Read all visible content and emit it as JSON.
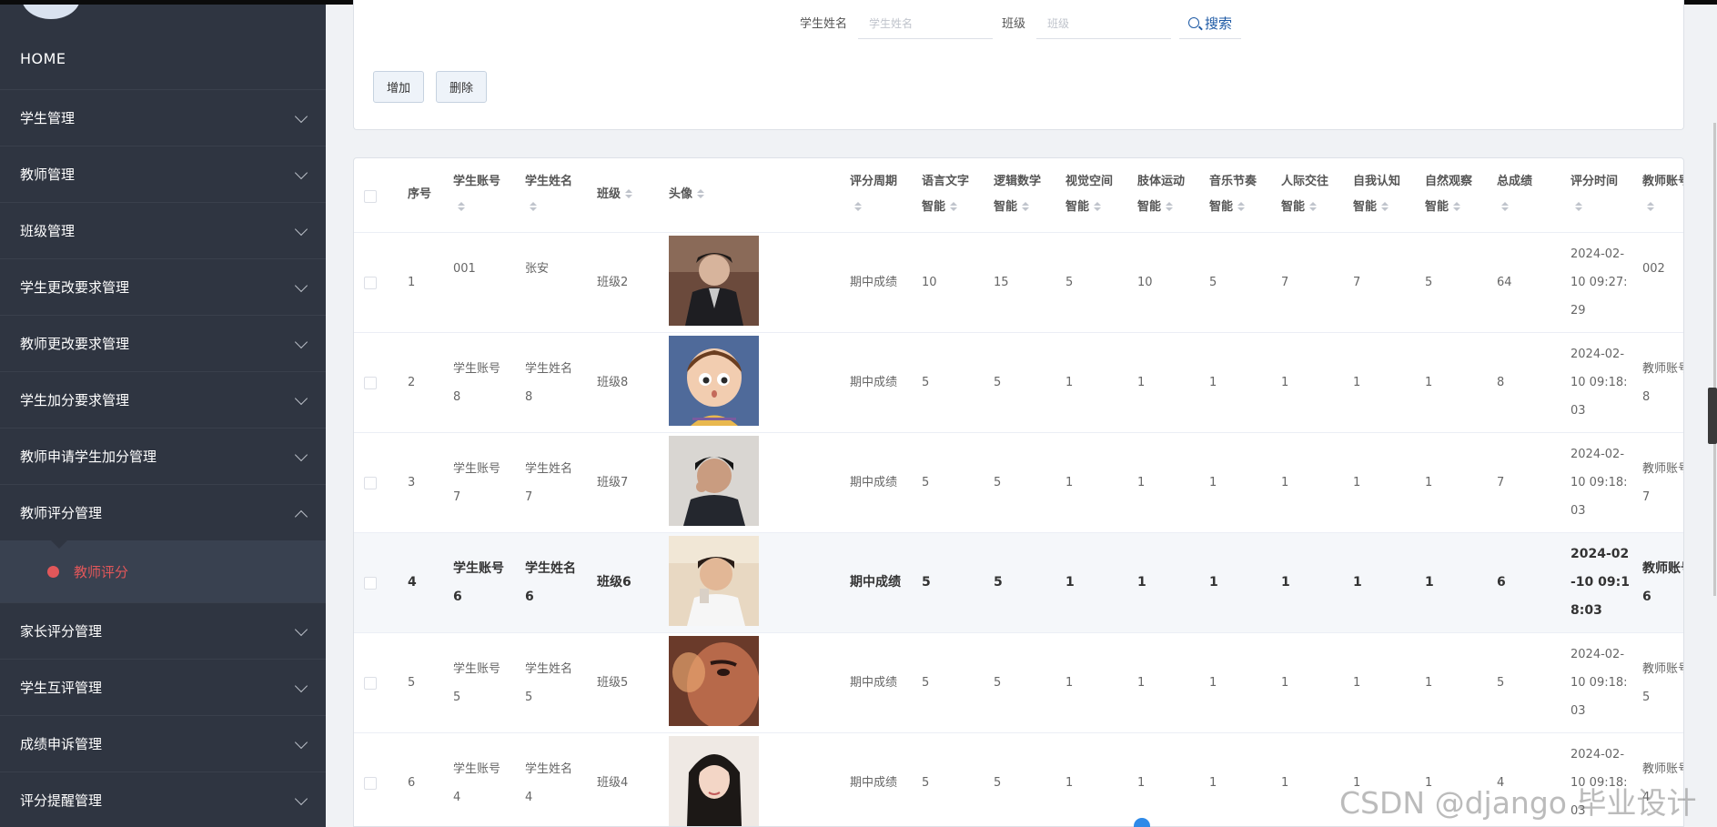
{
  "sidebar": {
    "home": "HOME",
    "items": [
      {
        "label": "学生管理"
      },
      {
        "label": "教师管理"
      },
      {
        "label": "班级管理"
      },
      {
        "label": "学生更改要求管理"
      },
      {
        "label": "教师更改要求管理"
      },
      {
        "label": "学生加分要求管理"
      },
      {
        "label": "教师申请学生加分管理"
      },
      {
        "label": "教师评分管理"
      }
    ],
    "active_sub": "教师评分",
    "items_after": [
      {
        "label": "家长评分管理"
      },
      {
        "label": "学生互评管理"
      },
      {
        "label": "成绩申诉管理"
      },
      {
        "label": "评分提醒管理"
      }
    ]
  },
  "search": {
    "name_label": "学生姓名",
    "name_placeholder": "学生姓名",
    "class_label": "班级",
    "class_placeholder": "班级",
    "search_button": "搜索",
    "add_button": "增加",
    "delete_button": "删除"
  },
  "table": {
    "headers": {
      "index": "序号",
      "account": "学生账号",
      "name": "学生姓名",
      "class": "班级",
      "avatar": "头像",
      "period": "评分周期",
      "lang_1": "语言文字",
      "lang_2": "智能",
      "logic_1": "逻辑数学",
      "logic_2": "智能",
      "visual_1": "视觉空间",
      "visual_2": "智能",
      "body_1": "肢体运动",
      "body_2": "智能",
      "music_1": "音乐节奏",
      "music_2": "智能",
      "inter_1": "人际交往",
      "inter_2": "智能",
      "self_1": "自我认知",
      "self_2": "智能",
      "nature_1": "自然观察",
      "nature_2": "智能",
      "total": "总成绩",
      "time": "评分时间",
      "teacher": "教师账号"
    },
    "rows": [
      {
        "index": "1",
        "account_1": "001",
        "account_2": "",
        "name_1": "张安",
        "name_2": "",
        "class": "班级2",
        "period": "期中成绩",
        "lang": "10",
        "logic": "15",
        "visual": "5",
        "body": "10",
        "music": "5",
        "inter": "7",
        "self": "7",
        "nature": "5",
        "total": "64",
        "time_1": "2024-02-",
        "time_2": "10 09:27:",
        "time_3": "29",
        "teacher_1": "002",
        "teacher_2": "",
        "avatar_icon": "avatar-man-jacket"
      },
      {
        "index": "2",
        "account_1": "学生账号",
        "account_2": "8",
        "name_1": "学生姓名",
        "name_2": "8",
        "class": "班级8",
        "period": "期中成绩",
        "lang": "5",
        "logic": "5",
        "visual": "1",
        "body": "1",
        "music": "1",
        "inter": "1",
        "self": "1",
        "nature": "1",
        "total": "8",
        "time_1": "2024-02-",
        "time_2": "10 09:18:",
        "time_3": "03",
        "teacher_1": "教师账号",
        "teacher_2": "8",
        "avatar_icon": "avatar-cartoon-boy"
      },
      {
        "index": "3",
        "account_1": "学生账号",
        "account_2": "7",
        "name_1": "学生姓名",
        "name_2": "7",
        "class": "班级7",
        "period": "期中成绩",
        "lang": "5",
        "logic": "5",
        "visual": "1",
        "body": "1",
        "music": "1",
        "inter": "1",
        "self": "1",
        "nature": "1",
        "total": "7",
        "time_1": "2024-02-",
        "time_2": "10 09:18:",
        "time_3": "03",
        "teacher_1": "教师账号",
        "teacher_2": "7",
        "avatar_icon": "avatar-man-cap"
      },
      {
        "index": "4",
        "account_1": "学生账号",
        "account_2": "6",
        "name_1": "学生姓名",
        "name_2": "6",
        "class": "班级6",
        "period": "期中成绩",
        "lang": "5",
        "logic": "5",
        "visual": "1",
        "body": "1",
        "music": "1",
        "inter": "1",
        "self": "1",
        "nature": "1",
        "total": "6",
        "time_1": "2024-02",
        "time_2": "-10 09:1",
        "time_3": "8:03",
        "teacher_1": "教师账号",
        "teacher_2": "6",
        "avatar_icon": "avatar-boy-smile"
      },
      {
        "index": "5",
        "account_1": "学生账号",
        "account_2": "5",
        "name_1": "学生姓名",
        "name_2": "5",
        "class": "班级5",
        "period": "期中成绩",
        "lang": "5",
        "logic": "5",
        "visual": "1",
        "body": "1",
        "music": "1",
        "inter": "1",
        "self": "1",
        "nature": "1",
        "total": "5",
        "time_1": "2024-02-",
        "time_2": "10 09:18:",
        "time_3": "03",
        "teacher_1": "教师账号",
        "teacher_2": "5",
        "avatar_icon": "avatar-face-closeup"
      },
      {
        "index": "6",
        "account_1": "学生账号",
        "account_2": "4",
        "name_1": "学生姓名",
        "name_2": "4",
        "class": "班级4",
        "period": "期中成绩",
        "lang": "5",
        "logic": "5",
        "visual": "1",
        "body": "1",
        "music": "1",
        "inter": "1",
        "self": "1",
        "nature": "1",
        "total": "4",
        "time_1": "2024-02-",
        "time_2": "10 09:18:",
        "time_3": "03",
        "teacher_1": "教师账号",
        "teacher_2": "4",
        "avatar_icon": "avatar-girl"
      }
    ]
  },
  "watermark": "CSDN @django 毕业设计"
}
